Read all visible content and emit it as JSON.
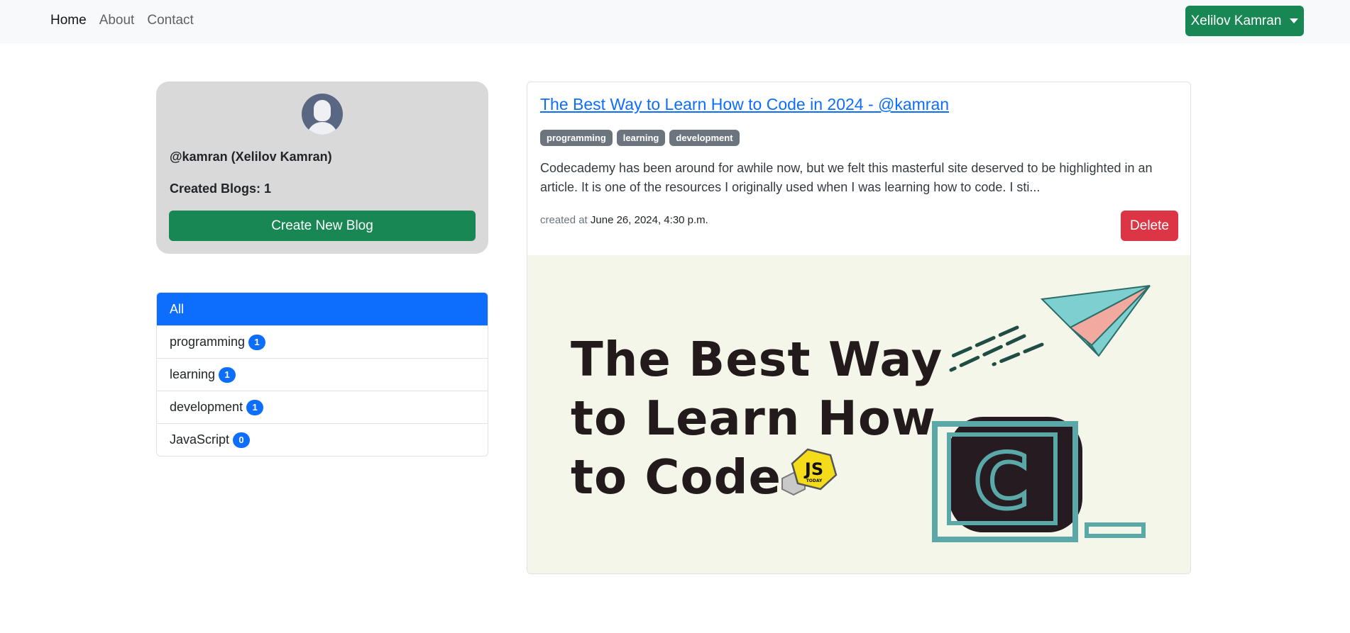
{
  "nav": {
    "links": [
      "Home",
      "About",
      "Contact"
    ],
    "user_menu_label": "Xelilov Kamran"
  },
  "profile": {
    "name": "@kamran (Xelilov Kamran)",
    "created_blogs": "Created Blogs: 1",
    "create_button": "Create New Blog"
  },
  "tag_filter": {
    "items": [
      {
        "label": "All"
      },
      {
        "label": "programming",
        "count": "1"
      },
      {
        "label": "learning",
        "count": "1"
      },
      {
        "label": "development",
        "count": "1"
      },
      {
        "label": "JavaScript",
        "count": "0"
      }
    ]
  },
  "blog": {
    "title": "The Best Way to Learn How to Code in 2024 - @kamran",
    "tags": [
      "programming",
      "learning",
      "development"
    ],
    "excerpt": "Codecademy has been around for awhile now, but we felt this masterful site deserved to be highlighted in an article. It is one of the resources I originally used when I was learning how to code. I sti...",
    "created_label": "created at",
    "created_date": "June 26, 2024, 4:30 p.m.",
    "delete_button": "Delete",
    "image": {
      "text": "The Best Way\nto Learn How\nto Code",
      "js_badge": "JS",
      "js_badge_small": "TODAY",
      "c_letter": "C"
    }
  },
  "colors": {
    "primary": "#0d6efd",
    "success": "#198754",
    "danger": "#dc3545",
    "secondary": "#6c757d"
  }
}
